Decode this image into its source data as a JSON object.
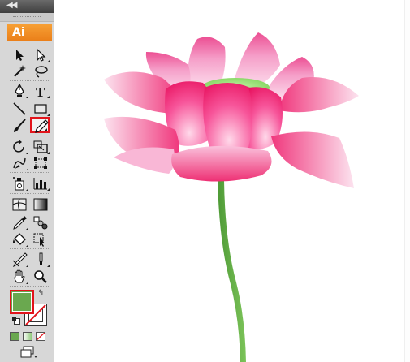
{
  "app": {
    "badge_label": "Ai"
  },
  "colors": {
    "fill": "#6aa84f",
    "stroke_none_slash": "#e2141b",
    "accent": "#ea7e18",
    "selected_outline": "#e2141b",
    "stem": "#6ab04c",
    "petal_pink": "#f0357a",
    "petal_light": "#f9c3de",
    "seedpod": "#9de07a"
  },
  "tools": [
    {
      "name": "selection-tool",
      "icon": "arrow-icon",
      "selected": false
    },
    {
      "name": "direct-selection-tool",
      "icon": "hollow-arrow-icon",
      "selected": false
    },
    {
      "name": "magic-wand-tool",
      "icon": "magic-wand-icon",
      "selected": false
    },
    {
      "name": "lasso-tool",
      "icon": "lasso-icon",
      "selected": false
    },
    {
      "name": "pen-tool",
      "icon": "pen-icon",
      "selected": false
    },
    {
      "name": "type-tool",
      "icon": "type-icon",
      "glyph": "T",
      "selected": false
    },
    {
      "name": "line-tool",
      "icon": "line-icon",
      "selected": false
    },
    {
      "name": "rectangle-tool",
      "icon": "rectangle-icon",
      "selected": false
    },
    {
      "name": "paintbrush-tool",
      "icon": "paintbrush-icon",
      "selected": false
    },
    {
      "name": "pencil-tool",
      "icon": "pencil-icon",
      "selected": true
    },
    {
      "name": "rotate-tool",
      "icon": "rotate-icon",
      "selected": false
    },
    {
      "name": "scale-tool",
      "icon": "scale-icon",
      "selected": false
    },
    {
      "name": "warp-tool",
      "icon": "warp-icon",
      "selected": false
    },
    {
      "name": "free-transform-tool",
      "icon": "free-transform-icon",
      "selected": false
    },
    {
      "name": "symbol-sprayer-tool",
      "icon": "symbol-sprayer-icon",
      "selected": false
    },
    {
      "name": "graph-tool",
      "icon": "column-graph-icon",
      "selected": false
    },
    {
      "name": "mesh-tool",
      "icon": "mesh-icon",
      "selected": false
    },
    {
      "name": "gradient-tool",
      "icon": "gradient-icon",
      "selected": false
    },
    {
      "name": "eyedropper-tool",
      "icon": "eyedropper-icon",
      "selected": false
    },
    {
      "name": "blend-tool",
      "icon": "blend-icon",
      "selected": false
    },
    {
      "name": "live-paint-bucket-tool",
      "icon": "paint-bucket-icon",
      "selected": false
    },
    {
      "name": "live-paint-selection-tool",
      "icon": "live-paint-selection-icon",
      "selected": false
    },
    {
      "name": "slice-tool",
      "icon": "slice-icon",
      "selected": false
    },
    {
      "name": "eraser-tool",
      "icon": "eraser-icon",
      "selected": false
    },
    {
      "name": "hand-tool",
      "icon": "hand-icon",
      "selected": false
    },
    {
      "name": "zoom-tool",
      "icon": "magnifier-icon",
      "selected": false
    }
  ],
  "swatches": {
    "fill_color": "#6aa84f",
    "stroke": "none"
  },
  "modes": [
    {
      "name": "color-mode",
      "icon": "color-icon"
    },
    {
      "name": "gradient-mode",
      "icon": "gradient-icon"
    },
    {
      "name": "none-mode",
      "icon": "none-icon"
    }
  ],
  "artwork": {
    "subject": "lotus-flower-illustration"
  }
}
